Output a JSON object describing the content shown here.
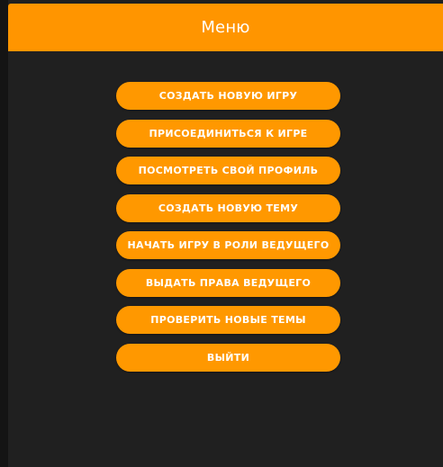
{
  "header": {
    "title": "Меню"
  },
  "menu": {
    "items": [
      {
        "label": "СОЗДАТЬ НОВУЮ ИГРУ"
      },
      {
        "label": "ПРИСОЕДИНИТЬСЯ К ИГРЕ"
      },
      {
        "label": "ПОСМОТРЕТЬ СВОЙ ПРОФИЛЬ"
      },
      {
        "label": "СОЗДАТЬ НОВУЮ ТЕМУ"
      },
      {
        "label": "НАЧАТЬ ИГРУ В РОЛИ ВЕДУЩЕГО"
      },
      {
        "label": "ВЫДАТЬ ПРАВА ВЕДУЩЕГО"
      },
      {
        "label": "ПРОВЕРИТЬ НОВЫЕ ТЕМЫ"
      },
      {
        "label": "ВЫЙТИ"
      }
    ]
  },
  "colors": {
    "accent": "#ff9800",
    "header": "#ff9500",
    "background": "#202020",
    "text_on_accent": "#ffffff"
  }
}
